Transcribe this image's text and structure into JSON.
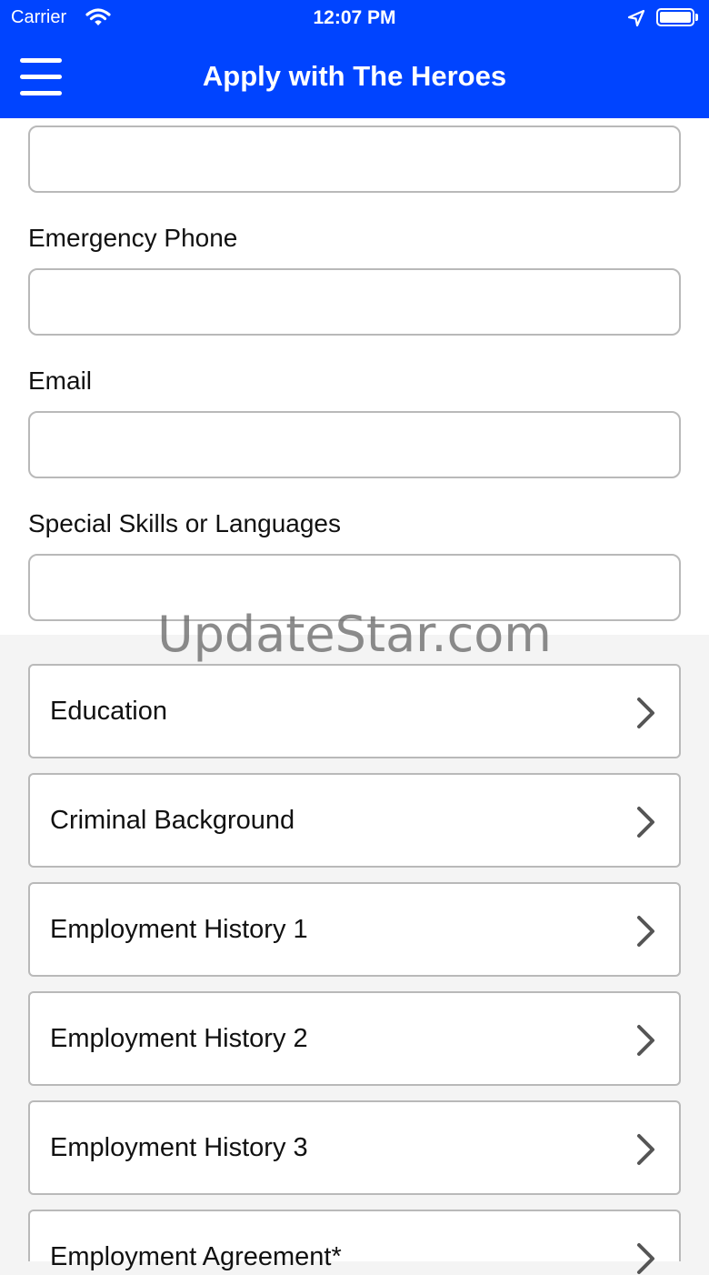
{
  "status_bar": {
    "carrier": "Carrier",
    "time": "12:07 PM",
    "wifi_icon": "wifi-icon",
    "location_icon": "location-arrow-icon",
    "battery_icon": "battery-icon"
  },
  "header": {
    "title": "Apply with The Heroes",
    "menu_icon": "hamburger-menu-icon",
    "background_color": "#0044ff"
  },
  "form": {
    "fields": [
      {
        "label": "",
        "value": ""
      },
      {
        "label": "Emergency Phone",
        "value": ""
      },
      {
        "label": "Email",
        "value": ""
      },
      {
        "label": "Special Skills or Languages",
        "value": ""
      }
    ]
  },
  "watermark": "UpdateStar.com",
  "sections": [
    {
      "label": "Education",
      "icon": "chevron-right-icon"
    },
    {
      "label": "Criminal Background",
      "icon": "chevron-right-icon"
    },
    {
      "label": "Employment History 1",
      "icon": "chevron-right-icon"
    },
    {
      "label": "Employment History 2",
      "icon": "chevron-right-icon"
    },
    {
      "label": "Employment History 3",
      "icon": "chevron-right-icon"
    },
    {
      "label": "Employment Agreement*",
      "icon": "chevron-right-icon"
    }
  ]
}
